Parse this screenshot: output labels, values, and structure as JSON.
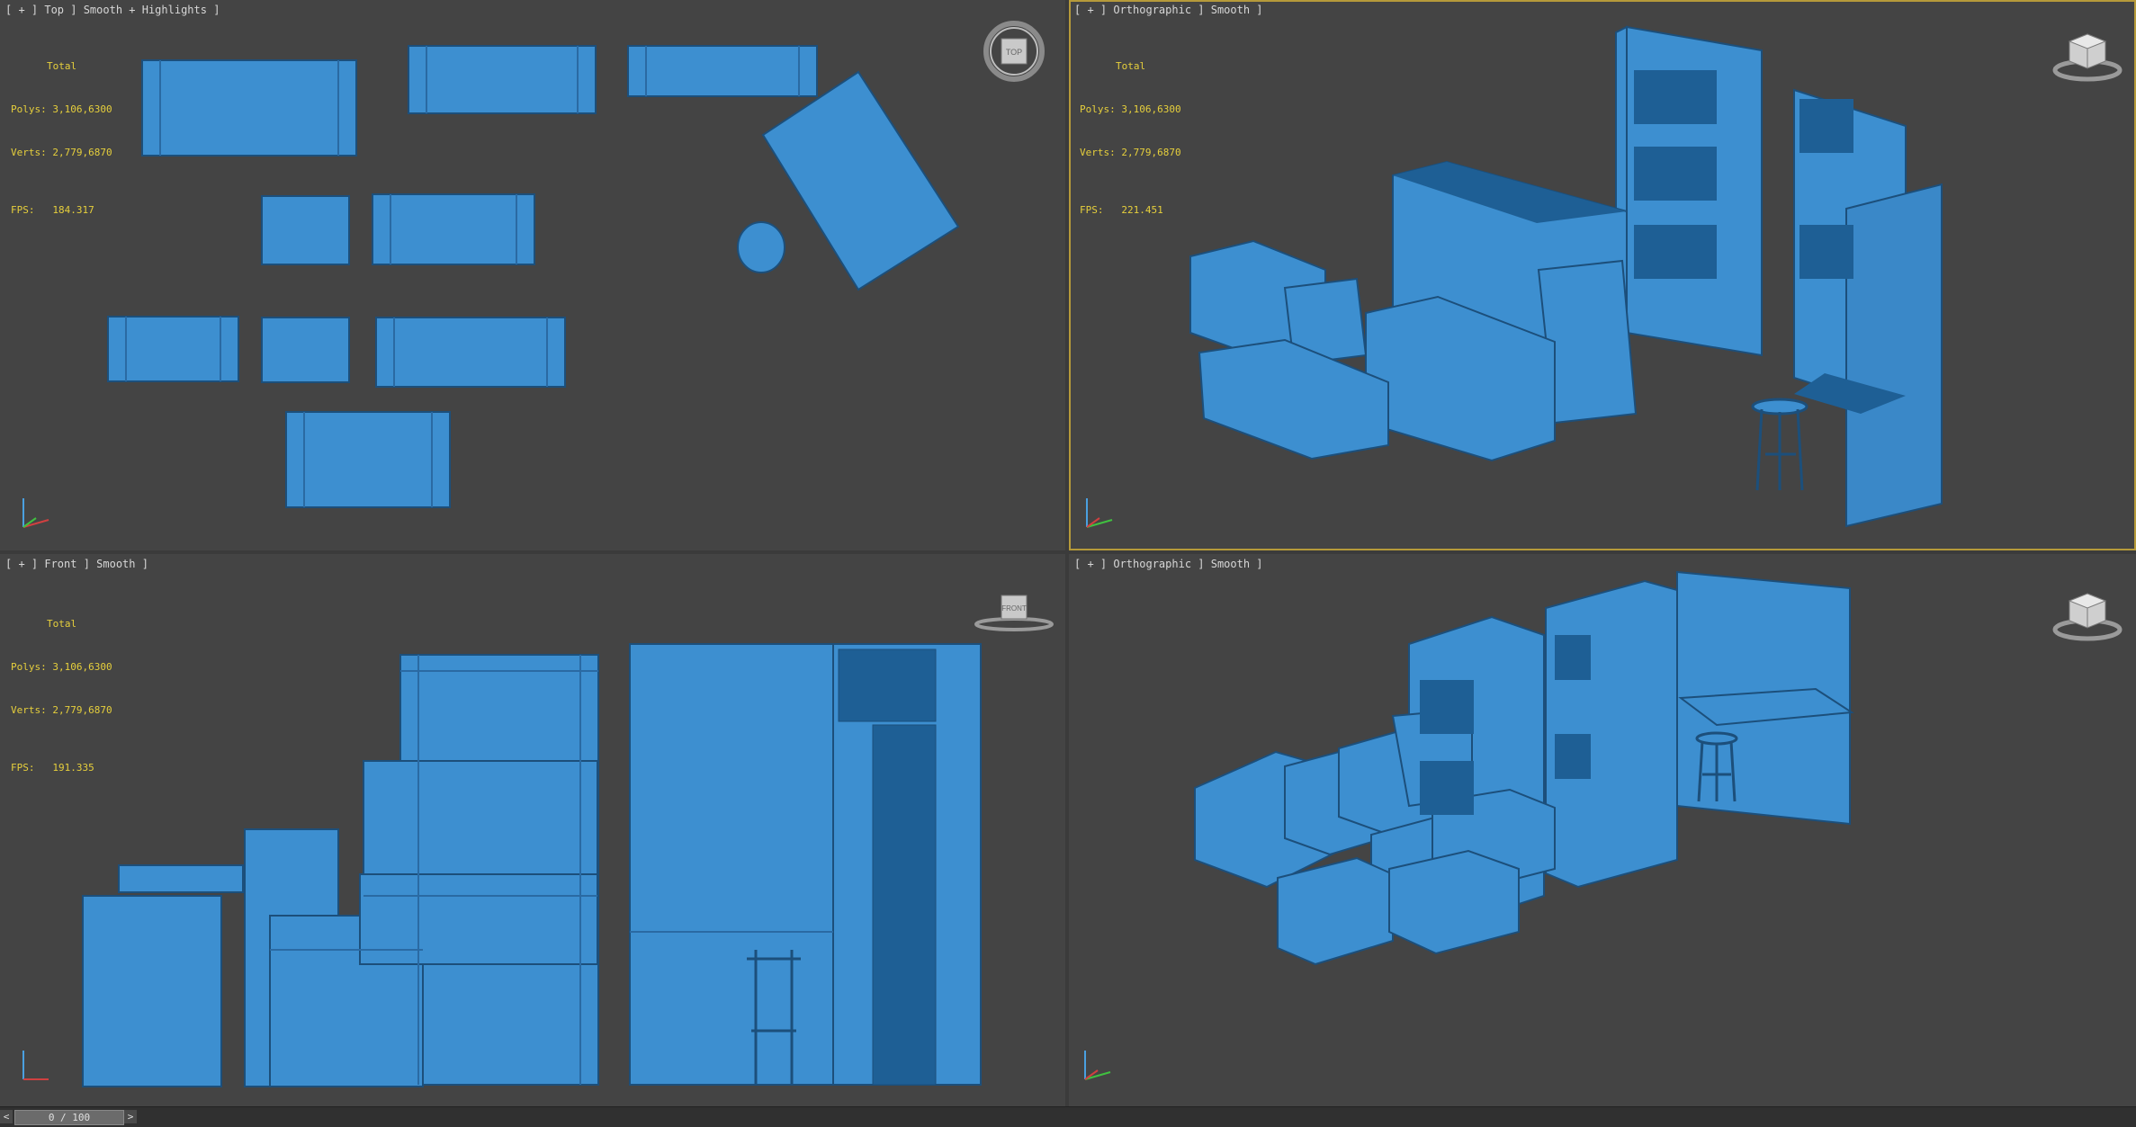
{
  "viewports": {
    "top": {
      "label": "[ + ] Top ] Smooth + Highlights ]",
      "stats": {
        "total": "Total",
        "polys": "Polys: 3,106,6300",
        "verts": "Verts: 2,779,6870",
        "fps": "FPS:   184.317"
      },
      "gizmo_text": "TOP"
    },
    "persp": {
      "label": "[ + ] Orthographic ] Smooth ]",
      "stats": {
        "total": "Total",
        "polys": "Polys: 3,106,6300",
        "verts": "Verts: 2,779,6870",
        "fps": "FPS:   221.451"
      }
    },
    "front": {
      "label": "[ + ] Front ] Smooth ]",
      "stats": {
        "total": "Total",
        "polys": "Polys: 3,106,6300",
        "verts": "Verts: 2,779,6870",
        "fps": "FPS:   191.335"
      },
      "gizmo_text": "FRONT"
    },
    "orth2": {
      "label": "[ + ] Orthographic ] Smooth ]"
    }
  },
  "timeline": {
    "frame": "0 / 100",
    "prev": "<",
    "next": ">"
  },
  "colors": {
    "model": "#3d8fd0",
    "model_dark": "#1e5f95",
    "edge": "#1c4f7b",
    "active_border": "#b69a3a",
    "stats_text": "#e6cf3c"
  }
}
